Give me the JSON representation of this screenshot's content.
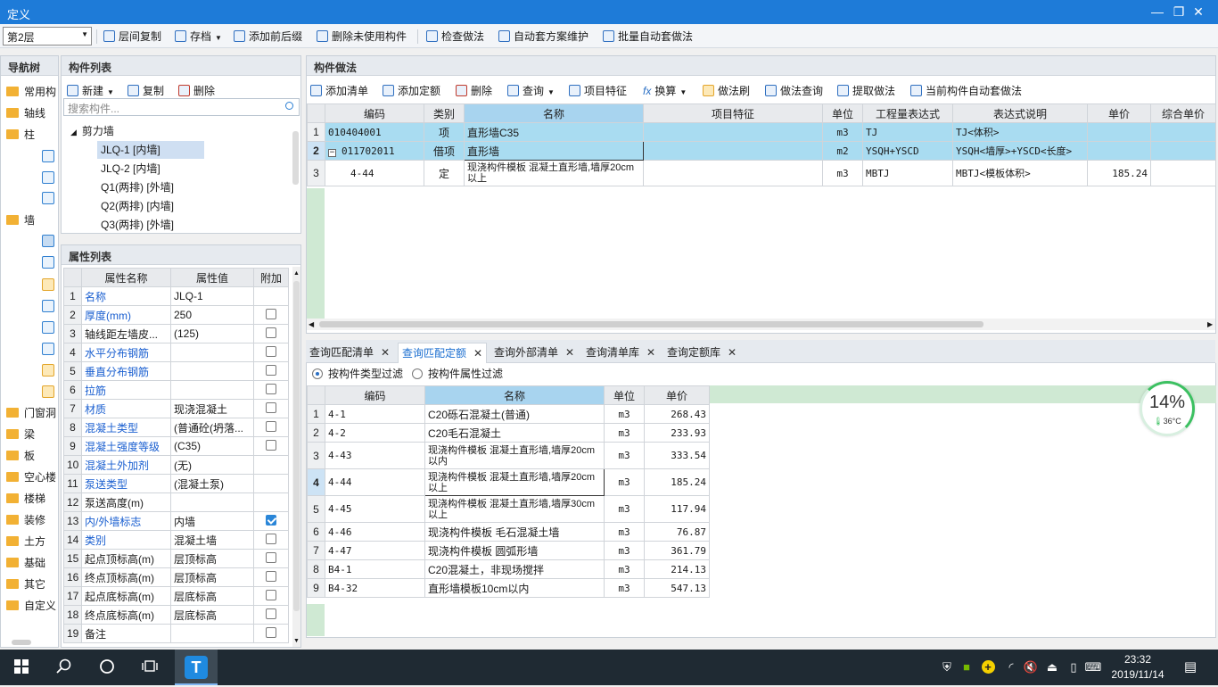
{
  "window": {
    "title": "定义",
    "min_label": "—",
    "max_label": "❐",
    "close_label": "✕"
  },
  "toolbar": {
    "floor_select": "第2层",
    "buttons": [
      "层间复制",
      "存档",
      "添加前后缀",
      "删除未使用构件",
      "检查做法",
      "自动套方案维护",
      "批量自动套做法"
    ]
  },
  "nav": {
    "title": "导航树",
    "items": [
      "常用构",
      "轴线",
      "柱",
      "墙",
      "门窗洞",
      "梁",
      "板",
      "空心楼",
      "楼梯",
      "装修",
      "土方",
      "基础",
      "其它",
      "自定义"
    ]
  },
  "component_list": {
    "title": "构件列表",
    "actions": [
      "新建",
      "复制",
      "删除"
    ],
    "search_placeholder": "搜索构件...",
    "group": "剪力墙",
    "items": [
      "JLQ-1 [内墙]",
      "JLQ-2 [内墙]",
      "Q1(两排) [外墙]",
      "Q2(两排) [内墙]",
      "Q3(两排) [外墙]"
    ]
  },
  "properties": {
    "title": "属性列表",
    "headers": [
      "属性名称",
      "属性值",
      "附加"
    ],
    "rows": [
      {
        "n": "1",
        "name": "名称",
        "value": "JLQ-1",
        "blue": true,
        "check": null
      },
      {
        "n": "2",
        "name": "厚度(mm)",
        "value": "250",
        "blue": true,
        "check": false
      },
      {
        "n": "3",
        "name": "轴线距左墙皮...",
        "value": "(125)",
        "blue": false,
        "check": false
      },
      {
        "n": "4",
        "name": "水平分布钢筋",
        "value": "",
        "blue": true,
        "check": false
      },
      {
        "n": "5",
        "name": "垂直分布钢筋",
        "value": "",
        "blue": true,
        "check": false
      },
      {
        "n": "6",
        "name": "拉筋",
        "value": "",
        "blue": true,
        "check": false
      },
      {
        "n": "7",
        "name": "材质",
        "value": "现浇混凝土",
        "blue": true,
        "check": false
      },
      {
        "n": "8",
        "name": "混凝土类型",
        "value": "(普通砼(坍落...",
        "blue": true,
        "check": false
      },
      {
        "n": "9",
        "name": "混凝土强度等级",
        "value": "(C35)",
        "blue": true,
        "check": false
      },
      {
        "n": "10",
        "name": "混凝土外加剂",
        "value": "(无)",
        "blue": true,
        "check": null
      },
      {
        "n": "11",
        "name": "泵送类型",
        "value": "(混凝土泵)",
        "blue": true,
        "check": null
      },
      {
        "n": "12",
        "name": "泵送高度(m)",
        "value": "",
        "blue": false,
        "check": null
      },
      {
        "n": "13",
        "name": "内/外墙标志",
        "value": "内墙",
        "blue": true,
        "check": true
      },
      {
        "n": "14",
        "name": "类别",
        "value": "混凝土墙",
        "blue": true,
        "check": false
      },
      {
        "n": "15",
        "name": "起点顶标高(m)",
        "value": "层顶标高",
        "blue": false,
        "check": false
      },
      {
        "n": "16",
        "name": "终点顶标高(m)",
        "value": "层顶标高",
        "blue": false,
        "check": false
      },
      {
        "n": "17",
        "name": "起点底标高(m)",
        "value": "层底标高",
        "blue": false,
        "check": false
      },
      {
        "n": "18",
        "name": "终点底标高(m)",
        "value": "层底标高",
        "blue": false,
        "check": false
      },
      {
        "n": "19",
        "name": "备注",
        "value": "",
        "blue": false,
        "check": false
      }
    ]
  },
  "method": {
    "title": "构件做法",
    "actions": [
      "添加清单",
      "添加定额",
      "删除",
      "查询",
      "项目特征",
      "换算",
      "做法刷",
      "做法查询",
      "提取做法",
      "当前构件自动套做法"
    ],
    "headers": [
      "编码",
      "类别",
      "名称",
      "项目特征",
      "单位",
      "工程量表达式",
      "表达式说明",
      "单价",
      "综合单价"
    ],
    "rows": [
      {
        "n": "1",
        "code": "010404001",
        "type": "项",
        "name": "直形墙C35",
        "feature": "",
        "unit": "m3",
        "expr": "TJ",
        "desc": "TJ<体积>",
        "price": "",
        "total": ""
      },
      {
        "n": "2",
        "code": "011702011",
        "type": "借项",
        "name": "直形墙",
        "feature": "",
        "unit": "m2",
        "expr": "YSQH+YSCD",
        "desc": "YSQH<墙厚>+YSCD<长度>",
        "price": "",
        "total": ""
      },
      {
        "n": "3",
        "code": "4-44",
        "type": "定",
        "name": "现浇构件模板 混凝土直形墙,墙厚20cm以上",
        "feature": "",
        "unit": "m3",
        "expr": "MBTJ",
        "desc": "MBTJ<模板体积>",
        "price": "185.24",
        "total": ""
      }
    ]
  },
  "query": {
    "tabs": [
      "查询匹配清单",
      "查询匹配定额",
      "查询外部清单",
      "查询清单库",
      "查询定额库"
    ],
    "active_tab": 1,
    "filters": [
      "按构件类型过滤",
      "按构件属性过滤"
    ],
    "headers": [
      "编码",
      "名称",
      "单位",
      "单价"
    ],
    "rows": [
      {
        "n": "1",
        "code": "4-1",
        "name": "C20砾石混凝土(普通)",
        "unit": "m3",
        "price": "268.43"
      },
      {
        "n": "2",
        "code": "4-2",
        "name": "C20毛石混凝土",
        "unit": "m3",
        "price": "233.93"
      },
      {
        "n": "3",
        "code": "4-43",
        "name": "现浇构件模板 混凝土直形墙,墙厚20cm以内",
        "unit": "m3",
        "price": "333.54"
      },
      {
        "n": "4",
        "code": "4-44",
        "name": "现浇构件模板 混凝土直形墙,墙厚20cm以上",
        "unit": "m3",
        "price": "185.24"
      },
      {
        "n": "5",
        "code": "4-45",
        "name": "现浇构件模板 混凝土直形墙,墙厚30cm以上",
        "unit": "m3",
        "price": "117.94"
      },
      {
        "n": "6",
        "code": "4-46",
        "name": "现浇构件模板 毛石混凝土墙",
        "unit": "m3",
        "price": "76.87"
      },
      {
        "n": "7",
        "code": "4-47",
        "name": "现浇构件模板 圆弧形墙",
        "unit": "m3",
        "price": "361.79"
      },
      {
        "n": "8",
        "code": "B4-1",
        "name": "C20混凝土，非现场搅拌",
        "unit": "m3",
        "price": "214.13"
      },
      {
        "n": "9",
        "code": "B4-32",
        "name": "直形墙模板10cm以内",
        "unit": "m3",
        "price": "547.13"
      }
    ]
  },
  "widget": {
    "percent": "14%",
    "temp": "36°C"
  },
  "taskbar": {
    "time": "23:32",
    "date": "2019/11/14",
    "app_letter": "T"
  }
}
